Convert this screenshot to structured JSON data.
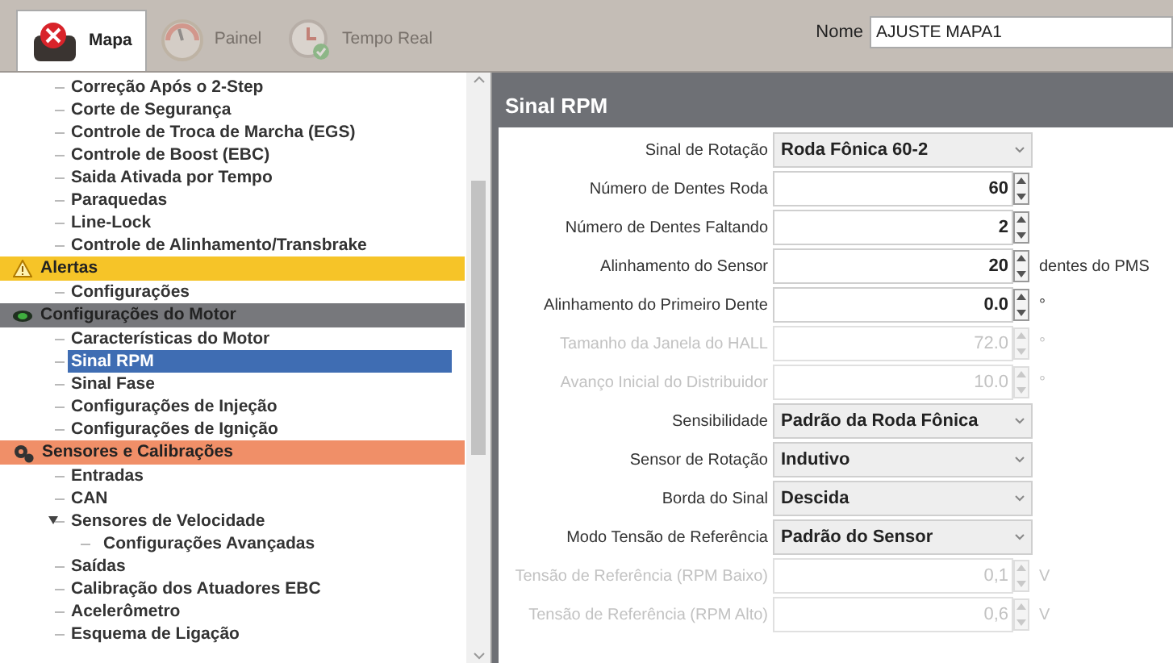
{
  "toolbar": {
    "tabs": [
      {
        "label": "Mapa",
        "kind": "map",
        "selected": true,
        "disabled": false
      },
      {
        "label": "Painel",
        "kind": "gauge",
        "selected": false,
        "disabled": true
      },
      {
        "label": "Tempo Real",
        "kind": "clock",
        "selected": false,
        "disabled": true
      }
    ],
    "name_label": "Nome",
    "name_value": "AJUSTE MAPA1"
  },
  "tree": [
    {
      "kind": "leaf",
      "label": "Correção Após o 2-Step",
      "selected": false
    },
    {
      "kind": "leaf",
      "label": "Corte de Segurança",
      "selected": false
    },
    {
      "kind": "leaf",
      "label": "Controle de Troca de Marcha (EGS)",
      "selected": false
    },
    {
      "kind": "leaf",
      "label": "Controle de Boost (EBC)",
      "selected": false
    },
    {
      "kind": "leaf",
      "label": "Saida Ativada por Tempo",
      "selected": false
    },
    {
      "kind": "leaf",
      "label": "Paraquedas",
      "selected": false
    },
    {
      "kind": "leaf",
      "label": "Line-Lock",
      "selected": false
    },
    {
      "kind": "leaf",
      "label": "Controle de Alinhamento/Transbrake",
      "selected": false
    },
    {
      "kind": "alert_group",
      "label": "Alertas",
      "color": "#f6c428",
      "children": [
        {
          "label": "Configurações",
          "selected": false
        }
      ]
    },
    {
      "kind": "engine_group",
      "label": "Configurações do Motor",
      "color": "#77787c",
      "children": [
        {
          "label": "Características do Motor",
          "selected": false
        },
        {
          "label": "Sinal RPM",
          "selected": true
        },
        {
          "label": "Sinal Fase",
          "selected": false
        },
        {
          "label": "Configurações de Injeção",
          "selected": false
        },
        {
          "label": "Configurações de Ignição",
          "selected": false
        }
      ]
    },
    {
      "kind": "sensor_group",
      "label": "Sensores e Calibrações",
      "color": "#f08f68",
      "children": [
        {
          "label": "Entradas",
          "selected": false
        },
        {
          "label": "CAN",
          "selected": false
        },
        {
          "label": "Sensores de Velocidade",
          "selected": false,
          "expanded": true,
          "children": [
            {
              "label": "Configurações Avançadas",
              "selected": false
            }
          ]
        },
        {
          "label": "Saídas",
          "selected": false
        },
        {
          "label": "Calibração dos Atuadores EBC",
          "selected": false
        },
        {
          "label": "Acelerômetro",
          "selected": false
        },
        {
          "label": "Esquema de Ligação",
          "selected": false
        }
      ]
    }
  ],
  "panel": {
    "title": "Sinal RPM",
    "fields": [
      {
        "kind": "select",
        "label": "Sinal de Rotação",
        "value": "Roda Fônica 60-2",
        "disabled": false
      },
      {
        "kind": "spin",
        "label": "Número de Dentes Roda",
        "value": "60",
        "disabled": false
      },
      {
        "kind": "spin",
        "label": "Número de Dentes Faltando",
        "value": "2",
        "disabled": false
      },
      {
        "kind": "spin",
        "label": "Alinhamento do Sensor",
        "value": "20",
        "unit": "dentes do PMS",
        "disabled": false
      },
      {
        "kind": "spin",
        "label": "Alinhamento do Primeiro Dente",
        "value": "0.0",
        "unit": "°",
        "disabled": false
      },
      {
        "kind": "spin",
        "label": "Tamanho da Janela do HALL",
        "value": "72.0",
        "unit": "°",
        "disabled": true
      },
      {
        "kind": "spin",
        "label": "Avanço Inicial do Distribuidor",
        "value": "10.0",
        "unit": "°",
        "disabled": true
      },
      {
        "kind": "select",
        "label": "Sensibilidade",
        "value": "Padrão da Roda Fônica",
        "disabled": false
      },
      {
        "kind": "select",
        "label": "Sensor de Rotação",
        "value": "Indutivo",
        "disabled": false
      },
      {
        "kind": "select",
        "label": "Borda do Sinal",
        "value": "Descida",
        "disabled": false
      },
      {
        "kind": "select",
        "label": "Modo Tensão de Referência",
        "value": "Padrão do Sensor",
        "disabled": false
      },
      {
        "kind": "spin",
        "label": "Tensão de Referência (RPM Baixo)",
        "value": "0,1",
        "unit": "V",
        "disabled": true
      },
      {
        "kind": "spin",
        "label": "Tensão de Referência (RPM Alto)",
        "value": "0,6",
        "unit": "V",
        "disabled": true
      }
    ]
  }
}
